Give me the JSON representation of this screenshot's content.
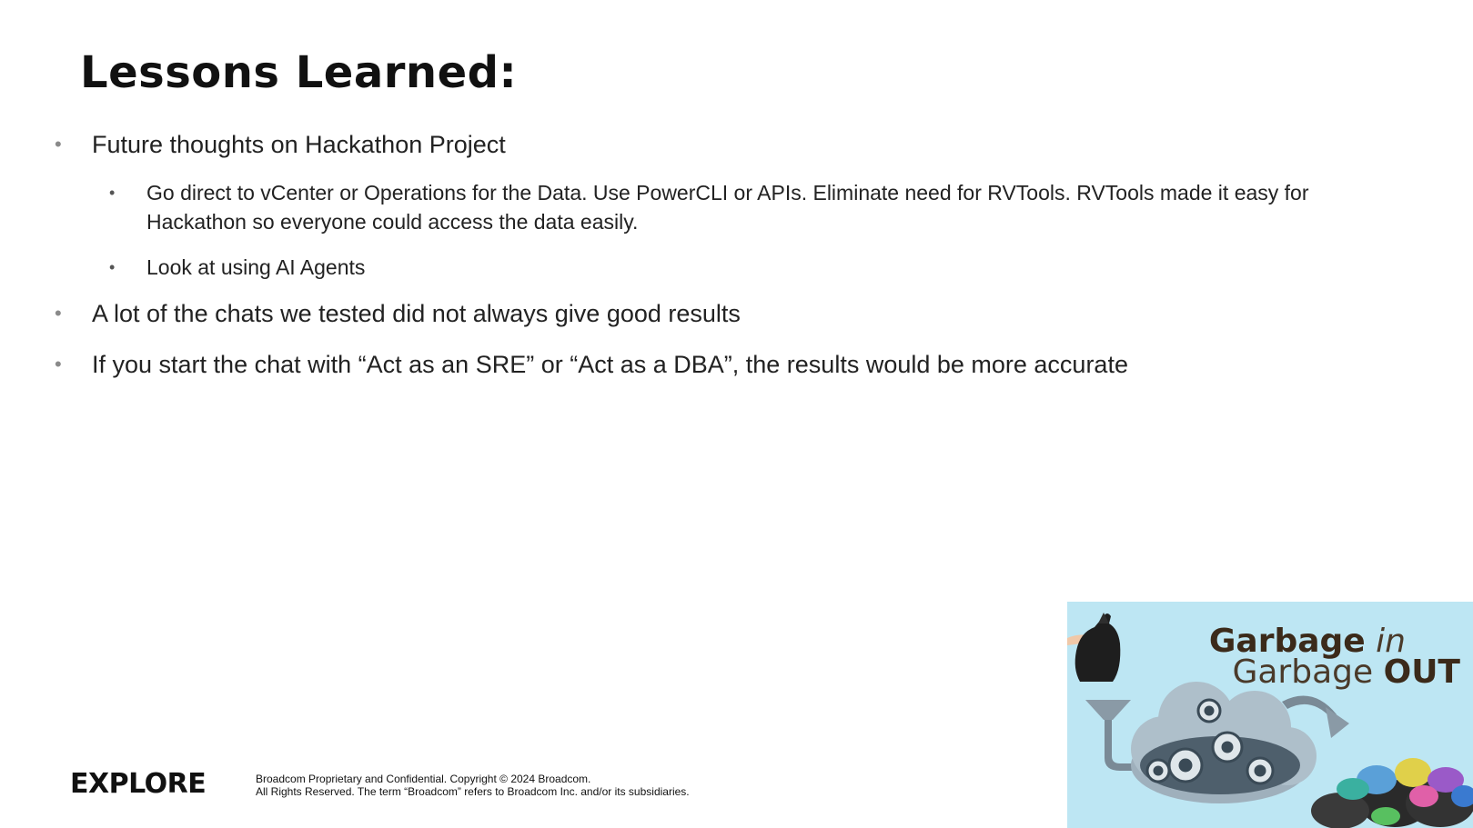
{
  "slide": {
    "title": "Lessons Learned:"
  },
  "bullets": {
    "b1": "Future thoughts on Hackathon Project",
    "b1_sub1": "Go direct to vCenter or Operations for the Data. Use PowerCLI or APIs. Eliminate need for RVTools. RVTools made it easy for Hackathon so everyone could access the data easily.",
    "b1_sub2": "Look at using AI Agents",
    "b2": "A lot of the chats we tested did not always give good results",
    "b3": "If you start the chat with “Act as an SRE” or “Act as a DBA”, the results would be more accurate"
  },
  "footer": {
    "logo": "EXPLORE",
    "legal_line1": "Broadcom Proprietary and Confidential. Copyright © 2024 Broadcom.",
    "legal_line2": "All Rights Reserved. The term “Broadcom” refers to Broadcom Inc. and/or its subsidiaries."
  },
  "promo": {
    "word1": "Garbage",
    "word2": "in",
    "word3": "Garbage",
    "word4": "OUT",
    "bg_color": "#bde6f3",
    "text_color": "#3b2a1a"
  }
}
